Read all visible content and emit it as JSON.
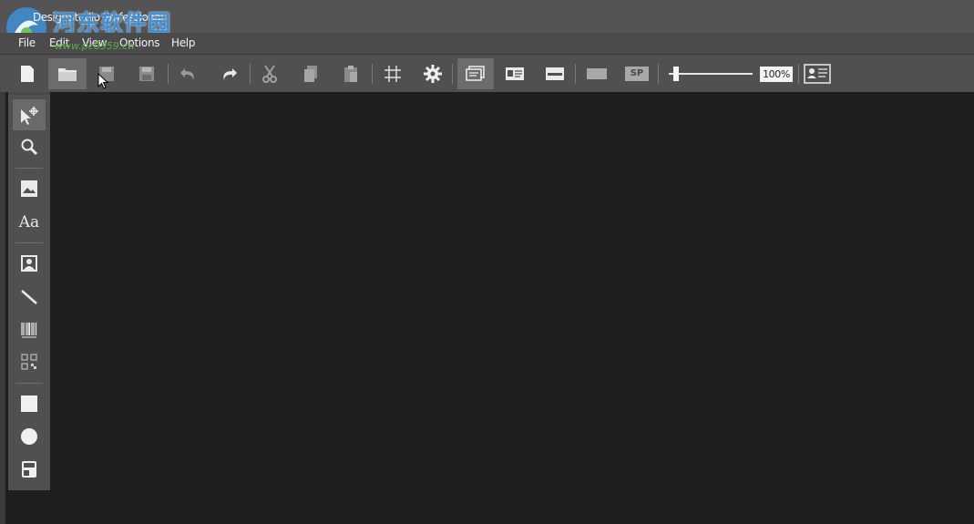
{
  "window": {
    "title": "DesignStudio Professional"
  },
  "watermark": {
    "text": "河东软件园",
    "url": "www.pc0359.cn"
  },
  "menu": [
    "File",
    "Edit",
    "View",
    "Options",
    "Help"
  ],
  "toolbar": {
    "buttons": [
      "new-document",
      "open-folder",
      "save",
      "save-as",
      "undo",
      "redo",
      "cut",
      "copy",
      "paste",
      "grid",
      "settings",
      "card-view",
      "card-front",
      "card-back",
      "blank-card",
      "sp"
    ],
    "sp_label": "SP",
    "zoom": {
      "label": "100%",
      "value_percent": 100
    },
    "last_button": "id-card-preview"
  },
  "sidebar": {
    "tools": [
      "select",
      "zoom",
      "image",
      "text",
      "photo",
      "line",
      "barcode",
      "qr-code",
      "rectangle",
      "ellipse",
      "stamp"
    ],
    "text_tool_label": "Aa"
  },
  "colors": {
    "canvas": "#1e1e1e",
    "toolbar": "#505050",
    "watermark_blue": "#3f8fd8"
  }
}
